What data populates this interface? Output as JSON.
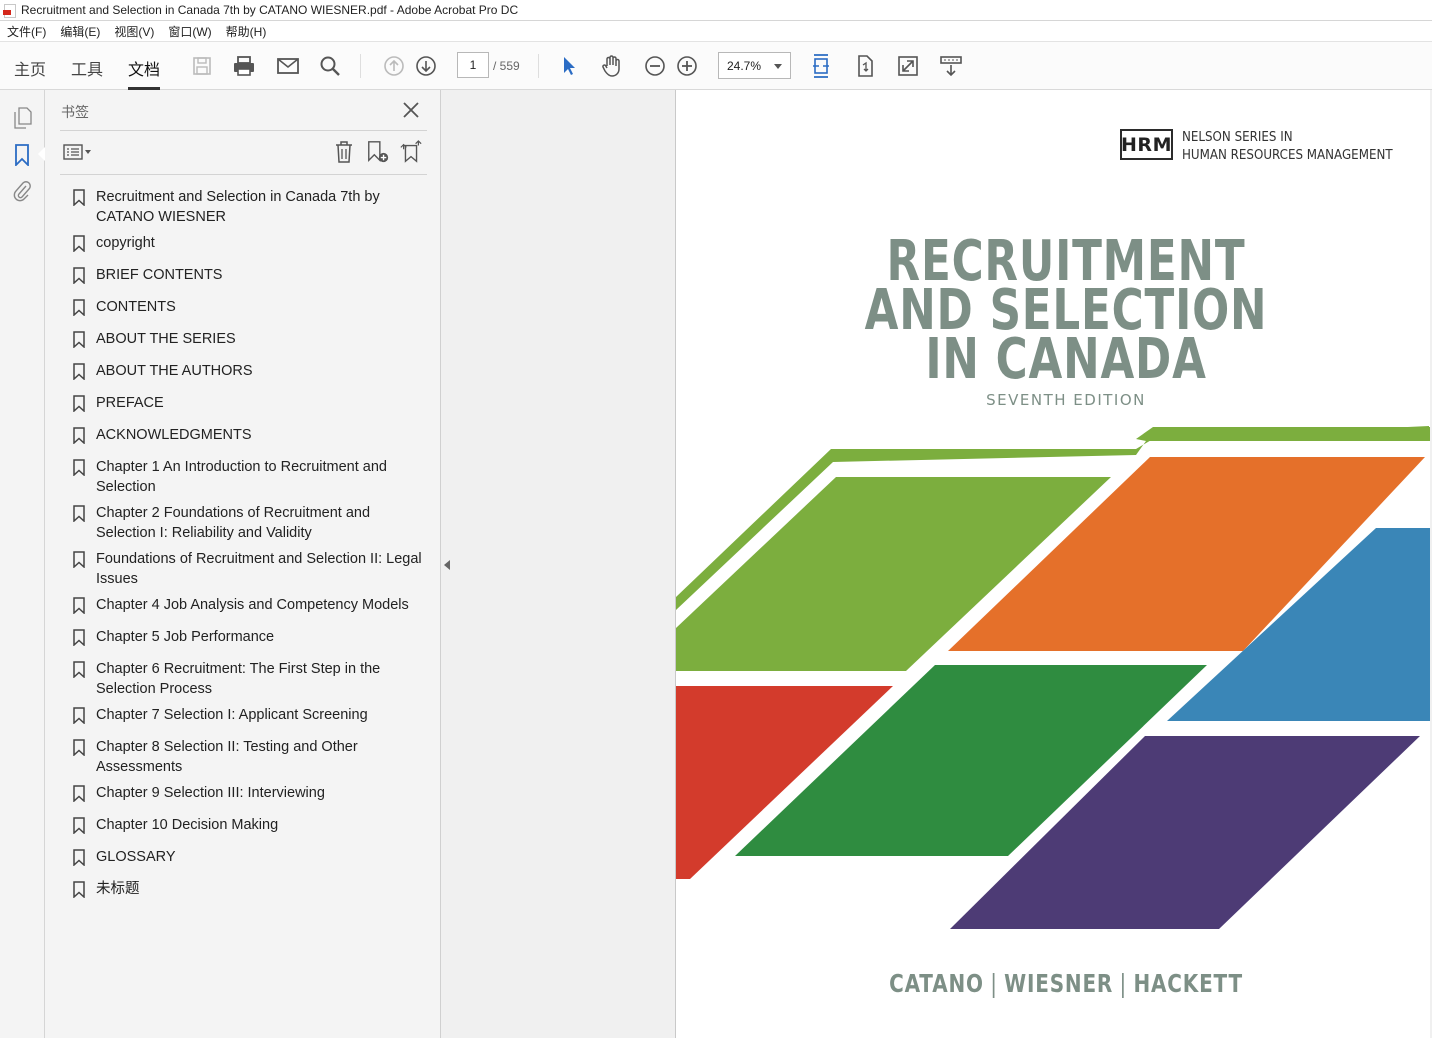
{
  "window": {
    "title": "Recruitment and Selection in Canada 7th by CATANO WIESNER.pdf - Adobe Acrobat Pro DC"
  },
  "menu": [
    "文件(F)",
    "编辑(E)",
    "视图(V)",
    "窗口(W)",
    "帮助(H)"
  ],
  "toolbar": {
    "tabs": {
      "home": "主页",
      "tools": "工具",
      "document": "文档"
    },
    "page_current": "1",
    "page_total": "/ 559",
    "zoom": "24.7%"
  },
  "bookmarks": {
    "title": "书签",
    "items": [
      "Recruitment and Selection in Canada 7th by CATANO WIESNER",
      "copyright",
      "BRIEF CONTENTS",
      "CONTENTS",
      "ABOUT THE SERIES",
      "ABOUT THE AUTHORS",
      "PREFACE",
      "ACKNOWLEDGMENTS",
      "Chapter 1 An Introduction to Recruitment and Selection",
      "Chapter 2 Foundations of Recruitment and Selection I: Reliability and Validity",
      "Foundations of Recruitment and Selection II: Legal Issues",
      "Chapter 4 Job Analysis and Competency Models",
      "Chapter 5 Job Performance",
      "Chapter 6 Recruitment: The First Step in the Selection Process",
      "Chapter 7 Selection I: Applicant Screening",
      "Chapter 8 Selection II: Testing and Other Assessments",
      "Chapter 9 Selection III: Interviewing",
      "Chapter 10 Decision Making",
      "GLOSSARY",
      "未标题"
    ]
  },
  "cover": {
    "hrm_logo": "HRM",
    "series_line1": "NELSON SERIES IN",
    "series_line2": "HUMAN RESOURCES MANAGEMENT",
    "title_line1": "RECRUITMENT",
    "title_line2": "AND SELECTION",
    "title_line3": "IN CANADA",
    "edition": "SEVENTH EDITION",
    "author1": "CATANO",
    "author2": "WIESNER",
    "author3": "HACKETT",
    "colors": {
      "title": "#7d8f86",
      "green_light": "#7cae3e",
      "orange": "#e5702a",
      "blue": "#3a86b7",
      "red": "#d33b2c",
      "green_dark": "#2f8c40",
      "purple": "#4d3b75"
    }
  }
}
